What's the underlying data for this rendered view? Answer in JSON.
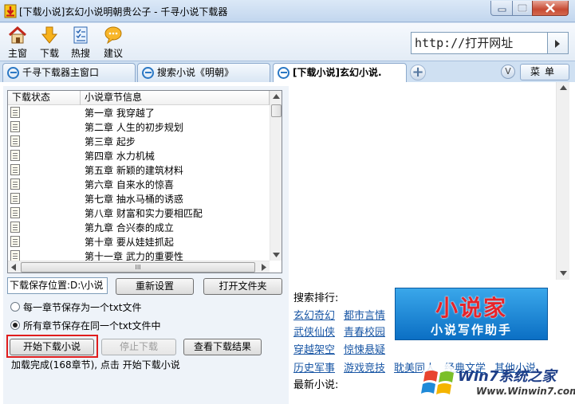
{
  "window": {
    "title": "[下载小说]玄幻小说明朝贵公子 - 千寻小说下载器"
  },
  "toolbar": {
    "items": [
      "主窗",
      "下载",
      "热搜",
      "建议"
    ],
    "url_value": "http://打开网址"
  },
  "tabs": [
    {
      "label": "千寻下载器主窗口"
    },
    {
      "label": "搜索小说《明朝》"
    },
    {
      "label": "[下载小说]玄幻小说."
    }
  ],
  "menu_label": "菜单",
  "tab_dropdown_label": "V",
  "list": {
    "headers": [
      "下载状态",
      "小说章节信息"
    ],
    "rows": [
      "第一章  我穿越了",
      "第二章  人生的初步规划",
      "第三章  起步",
      "第四章  水力机械",
      "第五章  新颖的建筑材料",
      "第六章  自来水的惊喜",
      "第七章  抽水马桶的诱惑",
      "第八章  财富和实力要相匹配",
      "第九章  合兴泰的成立",
      "第十章  要从娃娃抓起",
      "第十一章  武力的重要性"
    ],
    "hscroll_grip": "III"
  },
  "save": {
    "path": "下载保存位置:D:\\小说",
    "reset_label": "重新设置",
    "open_folder_label": "打开文件夹"
  },
  "options": {
    "per_chapter": "每一章节保存为一个txt文件",
    "single_file": "所有章节保存在同一个txt文件中",
    "selected": "single_file"
  },
  "actions": {
    "start_label": "开始下载小说",
    "stop_label": "停止下载",
    "view_label": "查看下载结果"
  },
  "status": "加载完成(168章节), 点击 开始下载小说",
  "right": {
    "rank_label": "搜索排行:",
    "rank_rows": [
      [
        "玄幻奇幻",
        "都市言情"
      ],
      [
        "武侠仙侠",
        "青春校园"
      ],
      [
        "穿越架空",
        "惊悚悬疑"
      ],
      [
        "历史军事",
        "游戏竞技",
        "耽美同人",
        "经典文学",
        "其他小说"
      ]
    ],
    "latest_label": "最新小说:",
    "logo_big": "小说家",
    "logo_small": "小说写作助手"
  },
  "watermark": {
    "text": "Win7系统之家",
    "url": "Www.Winwin7.com"
  },
  "colors": {
    "link": "#1a57a5",
    "highlight": "#e01d1d",
    "logo_blue": "#0b6fc4"
  }
}
